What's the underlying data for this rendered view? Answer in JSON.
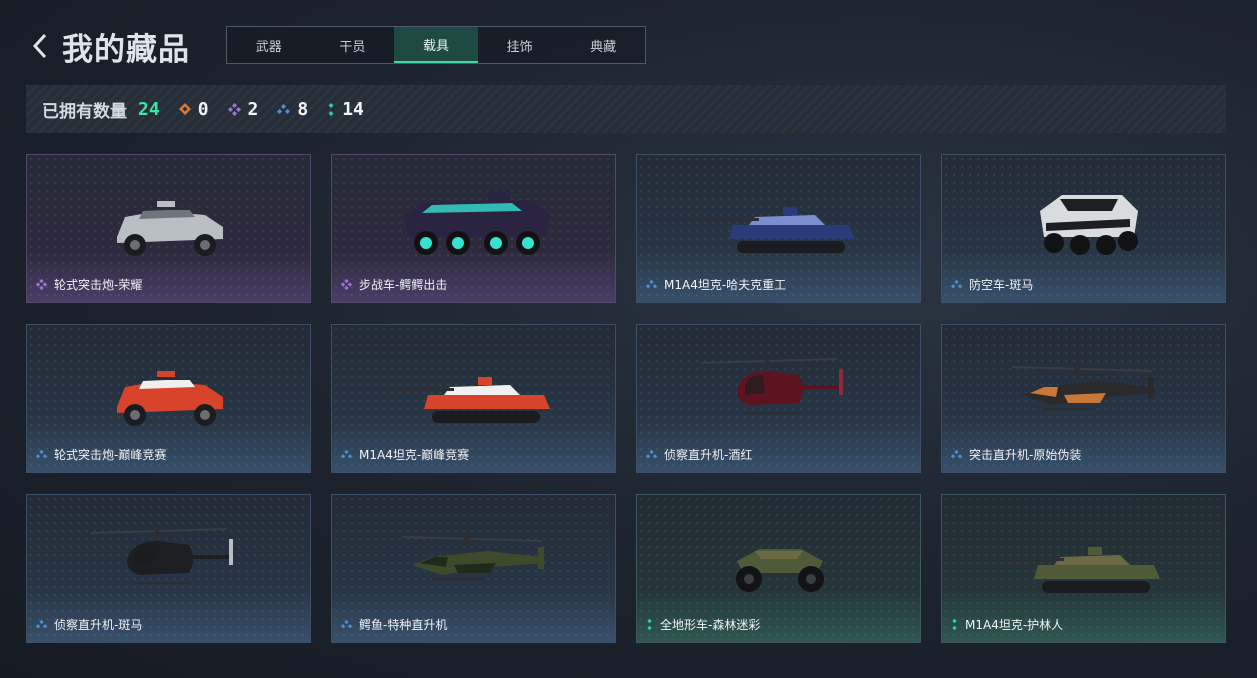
{
  "header": {
    "title": "我的藏品"
  },
  "tabs": [
    {
      "label": "武器",
      "active": false
    },
    {
      "label": "干员",
      "active": false
    },
    {
      "label": "载具",
      "active": true
    },
    {
      "label": "挂饰",
      "active": false
    },
    {
      "label": "典藏",
      "active": false
    }
  ],
  "stats": {
    "owned_label": "已拥有数量",
    "owned_total": "24",
    "rarities": [
      {
        "icon": "orange-diamond-icon",
        "count": "0",
        "color": "#d9783a"
      },
      {
        "icon": "purple-diamond-icon",
        "count": "2",
        "color": "#a071e0"
      },
      {
        "icon": "blue-diamond-icon",
        "count": "8",
        "color": "#4b8fd6"
      },
      {
        "icon": "green-diamond-icon",
        "count": "14",
        "color": "#2fd39a"
      }
    ]
  },
  "colors": {
    "accent": "#3ed6a5",
    "purple": "#a071e0",
    "blue": "#4b8fd6",
    "green": "#2fd39a"
  },
  "cards": [
    {
      "name": "轮式突击炮-荣耀",
      "rarity": "purple",
      "vehicle": "armored-car",
      "scheme": "silver"
    },
    {
      "name": "步战车-鳄鳄出击",
      "rarity": "purple",
      "vehicle": "ifv",
      "scheme": "graffiti"
    },
    {
      "name": "M1A4坦克-哈夫克重工",
      "rarity": "blue",
      "vehicle": "tank",
      "scheme": "navy"
    },
    {
      "name": "防空车-斑马",
      "rarity": "blue",
      "vehicle": "ifv-short",
      "scheme": "zebra"
    },
    {
      "name": "轮式突击炮-巅峰竞赛",
      "rarity": "blue",
      "vehicle": "armored-car",
      "scheme": "race"
    },
    {
      "name": "M1A4坦克-巅峰竞赛",
      "rarity": "blue",
      "vehicle": "tank",
      "scheme": "race"
    },
    {
      "name": "侦察直升机-酒红",
      "rarity": "blue",
      "vehicle": "little-heli",
      "scheme": "wine"
    },
    {
      "name": "突击直升机-原始伪装",
      "rarity": "blue",
      "vehicle": "attack-heli",
      "scheme": "black"
    },
    {
      "name": "侦察直升机-斑马",
      "rarity": "blue",
      "vehicle": "little-heli",
      "scheme": "zebra-dark"
    },
    {
      "name": "鳄鱼-特种直升机",
      "rarity": "blue",
      "vehicle": "attack-heli",
      "scheme": "green"
    },
    {
      "name": "全地形车-森林迷彩",
      "rarity": "green",
      "vehicle": "atv",
      "scheme": "camo"
    },
    {
      "name": "M1A4坦克-护林人",
      "rarity": "green",
      "vehicle": "tank",
      "scheme": "camo"
    }
  ]
}
